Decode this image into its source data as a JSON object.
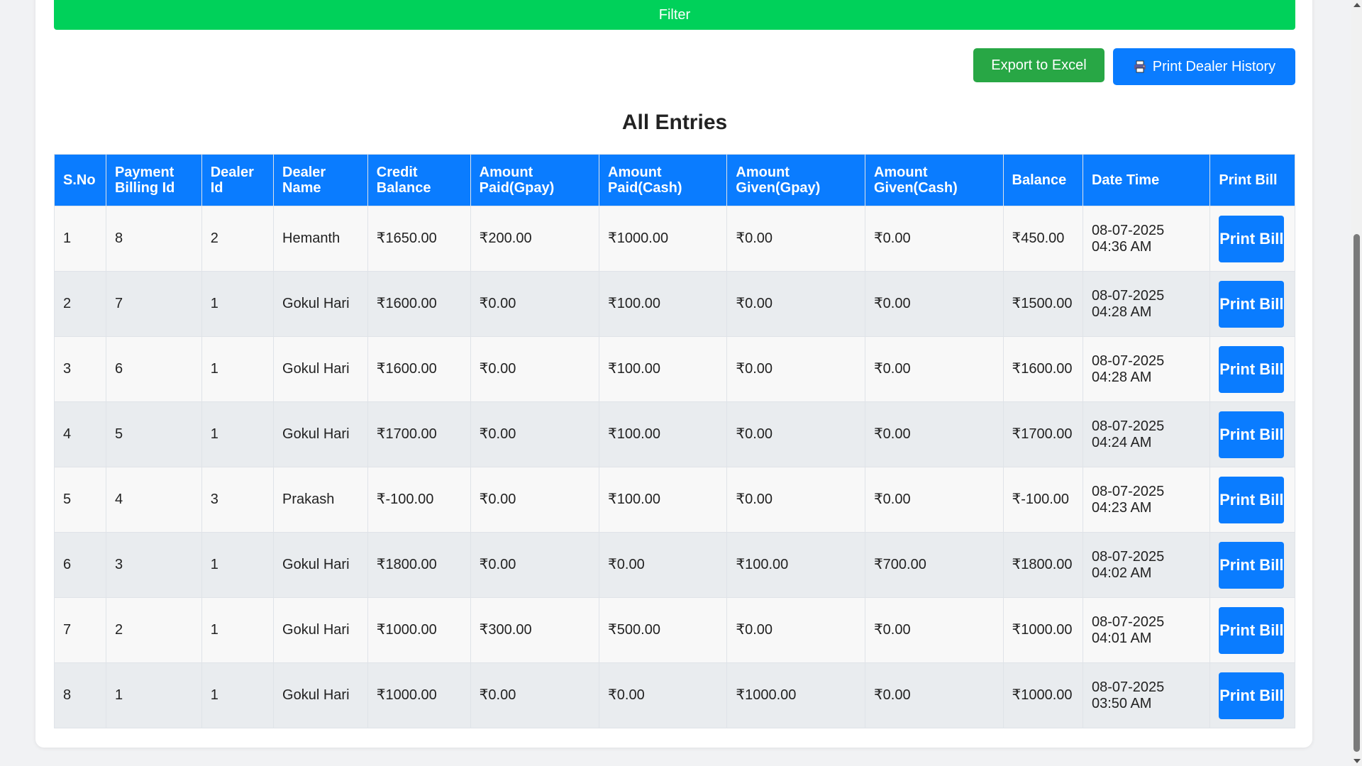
{
  "filter": {
    "label": "Filter"
  },
  "actions": {
    "export_label": "Export to Excel",
    "print_history_label": "Print Dealer History"
  },
  "heading": "All Entries",
  "table": {
    "columns": [
      "S.No",
      "Payment Billing Id",
      "Dealer Id",
      "Dealer Name",
      "Credit Balance",
      "Amount Paid(Gpay)",
      "Amount Paid(Cash)",
      "Amount Given(Gpay)",
      "Amount Given(Cash)",
      "Balance",
      "Date Time",
      "Print Bill"
    ],
    "print_bill_label": "Print Bill",
    "rows": [
      {
        "sno": "1",
        "billing_id": "8",
        "dealer_id": "2",
        "dealer_name": "Hemanth",
        "credit": "₹1650.00",
        "paid_gpay": "₹200.00",
        "paid_cash": "₹1000.00",
        "given_gpay": "₹0.00",
        "given_cash": "₹0.00",
        "balance": "₹450.00",
        "date": "08-07-2025",
        "time": "04:36 AM"
      },
      {
        "sno": "2",
        "billing_id": "7",
        "dealer_id": "1",
        "dealer_name": "Gokul Hari",
        "credit": "₹1600.00",
        "paid_gpay": "₹0.00",
        "paid_cash": "₹100.00",
        "given_gpay": "₹0.00",
        "given_cash": "₹0.00",
        "balance": "₹1500.00",
        "date": "08-07-2025",
        "time": "04:28 AM"
      },
      {
        "sno": "3",
        "billing_id": "6",
        "dealer_id": "1",
        "dealer_name": "Gokul Hari",
        "credit": "₹1600.00",
        "paid_gpay": "₹0.00",
        "paid_cash": "₹100.00",
        "given_gpay": "₹0.00",
        "given_cash": "₹0.00",
        "balance": "₹1600.00",
        "date": "08-07-2025",
        "time": "04:28 AM"
      },
      {
        "sno": "4",
        "billing_id": "5",
        "dealer_id": "1",
        "dealer_name": "Gokul Hari",
        "credit": "₹1700.00",
        "paid_gpay": "₹0.00",
        "paid_cash": "₹100.00",
        "given_gpay": "₹0.00",
        "given_cash": "₹0.00",
        "balance": "₹1700.00",
        "date": "08-07-2025",
        "time": "04:24 AM"
      },
      {
        "sno": "5",
        "billing_id": "4",
        "dealer_id": "3",
        "dealer_name": "Prakash",
        "credit": "₹-100.00",
        "paid_gpay": "₹0.00",
        "paid_cash": "₹100.00",
        "given_gpay": "₹0.00",
        "given_cash": "₹0.00",
        "balance": "₹-100.00",
        "date": "08-07-2025",
        "time": "04:23 AM"
      },
      {
        "sno": "6",
        "billing_id": "3",
        "dealer_id": "1",
        "dealer_name": "Gokul Hari",
        "credit": "₹1800.00",
        "paid_gpay": "₹0.00",
        "paid_cash": "₹0.00",
        "given_gpay": "₹100.00",
        "given_cash": "₹700.00",
        "balance": "₹1800.00",
        "date": "08-07-2025",
        "time": "04:02 AM"
      },
      {
        "sno": "7",
        "billing_id": "2",
        "dealer_id": "1",
        "dealer_name": "Gokul Hari",
        "credit": "₹1000.00",
        "paid_gpay": "₹300.00",
        "paid_cash": "₹500.00",
        "given_gpay": "₹0.00",
        "given_cash": "₹0.00",
        "balance": "₹1000.00",
        "date": "08-07-2025",
        "time": "04:01 AM"
      },
      {
        "sno": "8",
        "billing_id": "1",
        "dealer_id": "1",
        "dealer_name": "Gokul Hari",
        "credit": "₹1000.00",
        "paid_gpay": "₹0.00",
        "paid_cash": "₹0.00",
        "given_gpay": "₹1000.00",
        "given_cash": "₹0.00",
        "balance": "₹1000.00",
        "date": "08-07-2025",
        "time": "03:50 AM"
      }
    ]
  },
  "colors": {
    "filter": "#00d15a",
    "export": "#28a745",
    "primary": "#0a7cff"
  },
  "icons": {
    "printer": "printer-icon"
  }
}
